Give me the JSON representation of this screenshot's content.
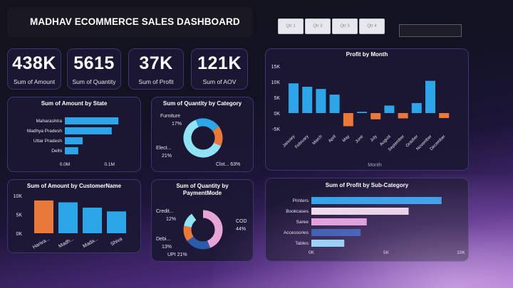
{
  "header": {
    "title": "MADHAV ECOMMERCE SALES DASHBOARD"
  },
  "slicer": {
    "buttons": [
      "Qtr 1",
      "Qtr 2",
      "Qtr 3",
      "Qtr 4"
    ]
  },
  "kpis": [
    {
      "value": "438K",
      "label": "Sum of Amount"
    },
    {
      "value": "5615",
      "label": "Sum of Quantity"
    },
    {
      "value": "37K",
      "label": "Sum of Profit"
    },
    {
      "value": "121K",
      "label": "Sum of AOV"
    }
  ],
  "colors": {
    "blue": "#2ca6e8",
    "orange": "#e8793a",
    "pink": "#e6a5d6",
    "navy": "#2a5aa8",
    "light": "#f2e2e8",
    "cyan": "#8fe3f5"
  },
  "chart_data": [
    {
      "type": "bar",
      "title": "Profit by Month",
      "xlabel": "Month",
      "categories": [
        "January",
        "February",
        "March",
        "April",
        "May",
        "June",
        "July",
        "August",
        "September",
        "October",
        "November",
        "December"
      ],
      "values": [
        9500,
        8400,
        7700,
        5900,
        -4200,
        400,
        -2000,
        2400,
        -1700,
        3200,
        10300,
        -1600
      ],
      "ylim": [
        -5000,
        15000
      ],
      "yticks": [
        "15K",
        "10K",
        "5K",
        "0K",
        "-5K"
      ]
    },
    {
      "type": "bar",
      "orientation": "horizontal",
      "title": "Sum of Amount by State",
      "categories": [
        "Maharashtra",
        "Madhya Pradesh",
        "Uttar Pradesh",
        "Delhi"
      ],
      "values": [
        0.12,
        0.105,
        0.04,
        0.03
      ],
      "xlim": [
        0,
        0.15
      ],
      "xticks": [
        "0.0M",
        "0.1M"
      ]
    },
    {
      "type": "pie",
      "title": "Sum of Quantity by Category",
      "slices": [
        {
          "name": "Clot...",
          "percent": 63,
          "label": "Clot... 63%"
        },
        {
          "name": "Elect...",
          "percent": 21,
          "label": "21%"
        },
        {
          "name": "Furniture",
          "percent": 17,
          "label": "17%"
        }
      ]
    },
    {
      "type": "bar",
      "title": "Sum of Amount by CustomerName",
      "categories": [
        "Hariva...",
        "Madh...",
        "Mada...",
        "Shiva"
      ],
      "values": [
        8700,
        8200,
        6800,
        5800
      ],
      "ylim": [
        0,
        10000
      ],
      "yticks": [
        "10K",
        "5K",
        "0K"
      ]
    },
    {
      "type": "pie",
      "title": "Sum of Quantity by PaymentMode",
      "slices": [
        {
          "name": "COD",
          "percent": 44,
          "label": "44%"
        },
        {
          "name": "UPI",
          "percent": 21,
          "label": "UPI 21%"
        },
        {
          "name": "Debi...",
          "percent": 13,
          "label": "13%"
        },
        {
          "name": "Credit...",
          "percent": 12,
          "label": "12%"
        }
      ]
    },
    {
      "type": "bar",
      "orientation": "horizontal",
      "title": "Sum of Profit by Sub-Category",
      "categories": [
        "Printers",
        "Bookcases",
        "Saree",
        "Accessories",
        "Tables"
      ],
      "values": [
        8700,
        6500,
        3700,
        3300,
        2200
      ],
      "xlim": [
        0,
        10000
      ],
      "xticks": [
        "0K",
        "5K",
        "10K"
      ]
    }
  ]
}
